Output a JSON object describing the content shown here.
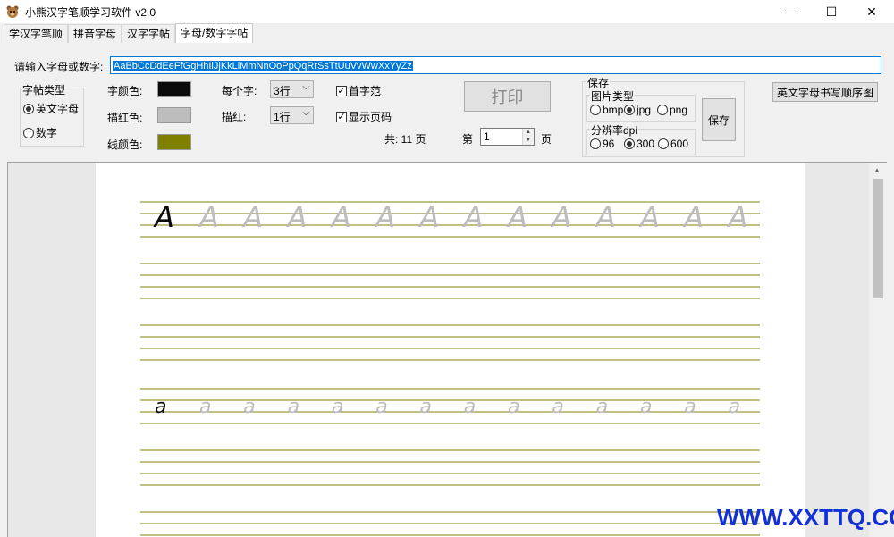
{
  "window": {
    "title": "小熊汉字笔顺学习软件 v2.0",
    "min": "—",
    "max": "☐",
    "close": "✕"
  },
  "tabs": [
    {
      "label": "学汉字笔顺"
    },
    {
      "label": "拼音字母"
    },
    {
      "label": "汉字字帖"
    },
    {
      "label": "字母/数字字帖"
    }
  ],
  "form": {
    "input_label": "请输入字母或数字:",
    "input_value": "AaBbCcDdEeFfGgHhIiJjKkLlMmNnOoPpQqRrSsTtUuVvWwXxYyZz",
    "type_group": {
      "title": "字帖类型",
      "options": [
        {
          "label": "英文字母",
          "checked": true
        },
        {
          "label": "数字",
          "checked": false
        }
      ]
    },
    "colors": {
      "char_color_label": "字颜色:",
      "char_color": "#0a0a0a",
      "trace_color_label": "描红色:",
      "trace_color": "#bdbdbd",
      "line_color_label": "线颜色:",
      "line_color": "#808000"
    },
    "per_char_label": "每个字:",
    "per_char_value": "3行",
    "trace_label": "描红:",
    "trace_value": "1行",
    "first_char_label": "首字范",
    "first_char_checked": true,
    "show_page_label": "显示页码",
    "show_page_checked": true,
    "print_label": "打印",
    "total_pages": "共: 11 页",
    "page_prefix": "第",
    "page_value": "1",
    "page_suffix": "页",
    "save_group": {
      "title": "保存",
      "image_type_title": "图片类型",
      "image_types": [
        {
          "label": "bmp",
          "checked": false
        },
        {
          "label": "jpg",
          "checked": true
        },
        {
          "label": "png",
          "checked": false
        }
      ],
      "dpi_title": "分辨率dpi",
      "dpi_options": [
        {
          "label": "96",
          "checked": false
        },
        {
          "label": "300",
          "checked": true
        },
        {
          "label": "600",
          "checked": false
        }
      ],
      "save_label": "保存"
    },
    "order_button_label": "英文字母书写顺序图"
  },
  "sheet": {
    "rows": [
      {
        "model": "A",
        "trace": "A",
        "trace_count": 13
      },
      {
        "model": "a",
        "trace": "a",
        "trace_count": 13
      }
    ]
  },
  "watermark": "WWW.XXTTQ.COM"
}
